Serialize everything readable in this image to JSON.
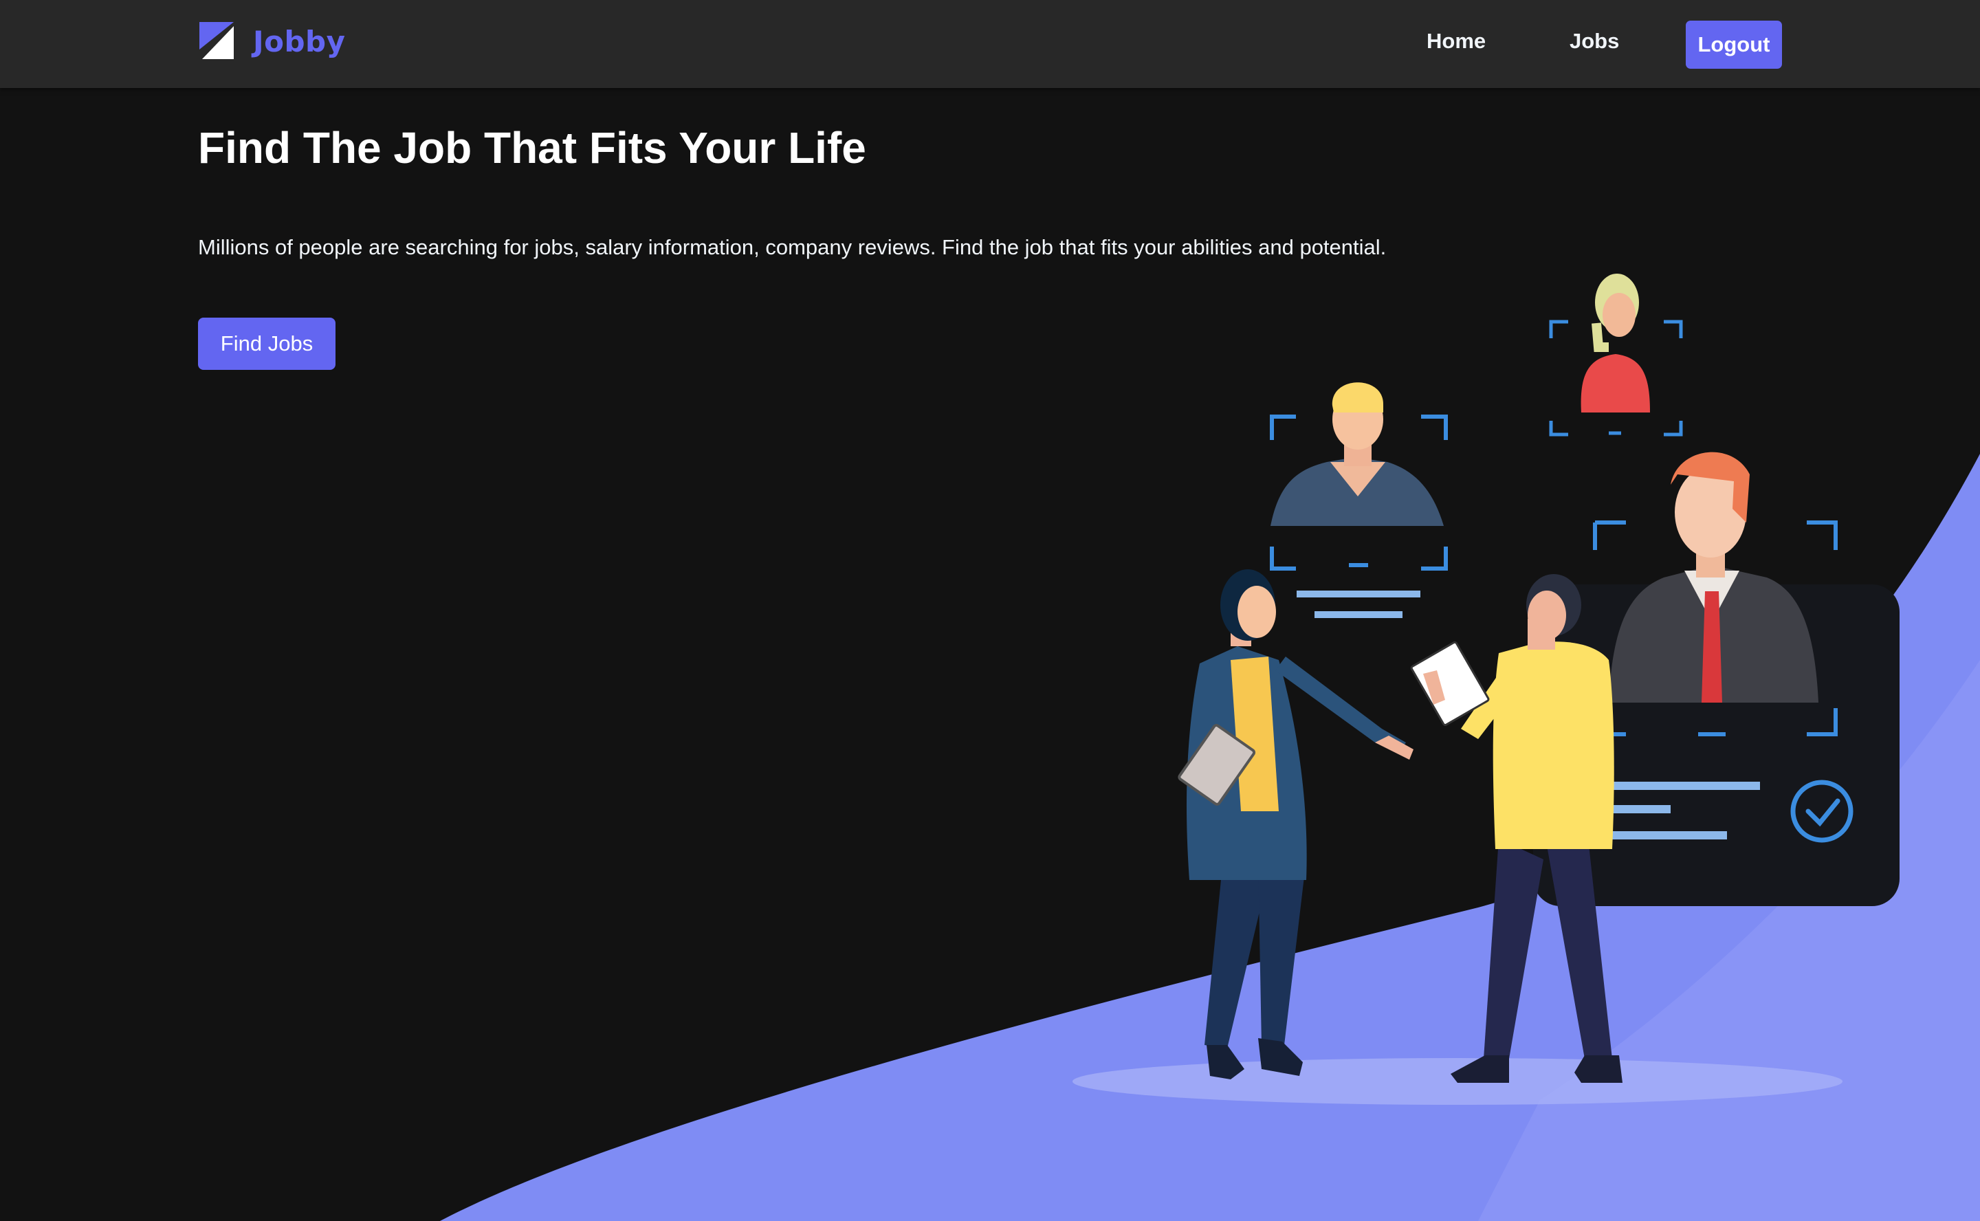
{
  "brand": {
    "name": "Jobby",
    "color": "#6366f1",
    "logo_icon": "jobby-logo-icon"
  },
  "nav": {
    "home_label": "Home",
    "jobs_label": "Jobs",
    "logout_label": "Logout"
  },
  "hero": {
    "title": "Find The Job That Fits Your Life",
    "description": "Millions of people are searching for jobs, salary information, company reviews. Find the job that fits your abilities and potential.",
    "cta_label": "Find Jobs"
  },
  "colors": {
    "background": "#121212",
    "navbar": "#282828",
    "accent": "#6366f1",
    "wave": "#7d8bf3"
  }
}
